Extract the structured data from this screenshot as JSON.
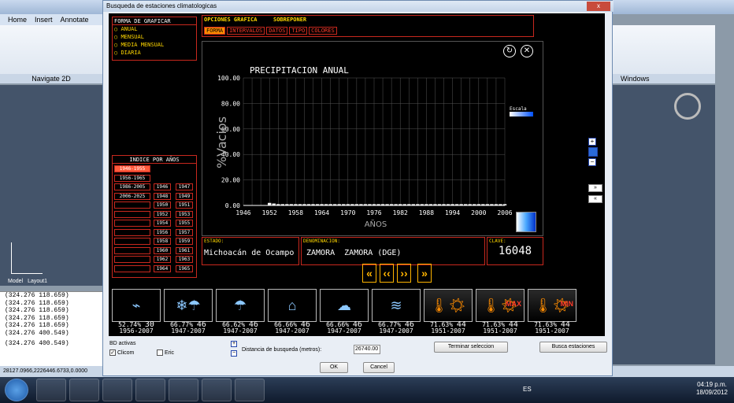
{
  "acad": {
    "tabs": [
      "Home",
      "Insert",
      "Annotate"
    ],
    "ribbon_label": "Navigate 2D",
    "right_label": "Windows",
    "model_tab": "Model",
    "layout_tab": "Layout1",
    "cmd_lines": [
      "(324.276 118.659)",
      "(324.276 118.659)",
      "(324.276 118.659)",
      "(324.276 118.659)",
      "(324.276 118.659)",
      "(324.276 400.549)",
      "(324.276 400.549)"
    ],
    "status": "28127.0966,2226446.6733,0.0000"
  },
  "dialog": {
    "title": "Busqueda de estaciones climatologicas",
    "close": "x"
  },
  "tipo": {
    "title": "FORMA DE GRAFICAR",
    "options": [
      "ANUAL",
      "MENSUAL",
      "MEDIA MENSUAL",
      "DIARIA"
    ]
  },
  "opciones": {
    "tab1": "OPCIONES GRAFICA",
    "tab2": "SOBREPONER",
    "sub": [
      "FORMA",
      "INTERVALOS",
      "DATOS",
      "TIPO",
      "COLORES"
    ]
  },
  "indice": {
    "title": "INDICE POR AÑOS",
    "ranges": [
      "1946-1955",
      "1956-1965",
      "1986-2005",
      "2006-2025"
    ],
    "years": [
      [
        "1946",
        "1947"
      ],
      [
        "1948",
        "1949"
      ],
      [
        "1950",
        "1951"
      ],
      [
        "1952",
        "1953"
      ],
      [
        "1954",
        "1955"
      ],
      [
        "1956",
        "1957"
      ],
      [
        "1958",
        "1959"
      ],
      [
        "1960",
        "1961"
      ],
      [
        "1962",
        "1963"
      ],
      [
        "1964",
        "1965"
      ]
    ]
  },
  "chart_data": {
    "type": "bar",
    "title": "PRECIPITACION ANUAL",
    "xlabel": "AÑOS",
    "ylabel": "%Vacios",
    "ylim": [
      0,
      100
    ],
    "yticks": [
      "0.00",
      "20.00",
      "40.00",
      "60.00",
      "80.00",
      "100.00"
    ],
    "xticks": [
      "1946",
      "1952",
      "1958",
      "1964",
      "1970",
      "1976",
      "1982",
      "1988",
      "1994",
      "2000",
      "2006"
    ],
    "legend": "Escala",
    "x": [
      1946,
      1947,
      1948,
      1949,
      1950,
      1951,
      1952,
      1953,
      1954,
      1955,
      1956,
      1957,
      1958,
      1959,
      1960,
      1961,
      1962,
      1963,
      1964,
      1965,
      1966,
      1967,
      1968,
      1969,
      1970,
      1971,
      1972,
      1973,
      1974,
      1975,
      1976,
      1977,
      1978,
      1979,
      1980,
      1981,
      1982,
      1983,
      1984,
      1985,
      1986,
      1987,
      1988,
      1989,
      1990,
      1991,
      1992,
      1993,
      1994,
      1995,
      1996,
      1997,
      1998,
      1999,
      2000,
      2001,
      2002,
      2003,
      2004,
      2005,
      2006,
      2007
    ],
    "values": [
      0,
      0,
      0,
      0,
      0,
      0,
      2,
      1.5,
      1,
      1,
      1,
      1,
      1,
      1,
      1,
      1,
      1,
      1,
      1,
      1,
      1,
      1,
      1,
      1,
      1,
      1,
      1,
      1,
      1,
      1,
      1,
      1,
      1,
      1,
      1,
      1,
      1,
      1,
      1,
      1,
      1,
      1,
      1,
      1,
      1,
      1,
      1,
      1,
      1,
      1,
      1,
      1,
      1,
      1,
      1,
      1,
      1,
      1,
      1,
      1,
      1,
      0
    ]
  },
  "info": {
    "estado_label": "ESTADO:",
    "estado": "Michoacán de Ocampo",
    "denom_label": "DENOMINACION:",
    "denom": "ZAMORA  ZAMORA (DGE)",
    "clave_label": "CLAVE:",
    "clave": "16048"
  },
  "nav": [
    "«",
    "‹‹",
    "››",
    "»"
  ],
  "icons": [
    {
      "pct": "52.74%",
      "n": "30",
      "range": "1956-2007"
    },
    {
      "pct": "66.77%",
      "n": "46",
      "range": "1947-2007"
    },
    {
      "pct": "66.62%",
      "n": "46",
      "range": "1947-2007"
    },
    {
      "pct": "66.66%",
      "n": "46",
      "range": "1947-2007"
    },
    {
      "pct": "66.66%",
      "n": "46",
      "range": "1947-2007"
    },
    {
      "pct": "66.77%",
      "n": "46",
      "range": "1947-2007"
    },
    {
      "pct": "71.63%",
      "n": "44",
      "range": "1951-2007"
    },
    {
      "pct": "71.63%",
      "n": "44",
      "range": "1951-2007"
    },
    {
      "pct": "71.63%",
      "n": "44",
      "range": "1951-2007"
    }
  ],
  "icon_names": [
    "estaciones-map-icon",
    "snow-rain-icon",
    "rain-icon",
    "town-icon",
    "storm-icon",
    "fog-icon",
    "temperature-icon",
    "temperature-max-icon",
    "temperature-min-icon"
  ],
  "icon_tags": {
    "max": "MAX",
    "min": "MIN"
  },
  "bottom": {
    "bd_label": "BD activas",
    "clicom": "Clicom",
    "eric": "Eric",
    "dist_label": "Distancia de busqueda (metros):",
    "dist_value": "26740.00",
    "terminar": "Terminar seleccion",
    "busca": "Busca estaciones",
    "ok": "OK",
    "cancel": "Cancel"
  },
  "taskbar": {
    "lang": "ES",
    "time": "04:19 p.m.",
    "date": "18/09/2012"
  }
}
